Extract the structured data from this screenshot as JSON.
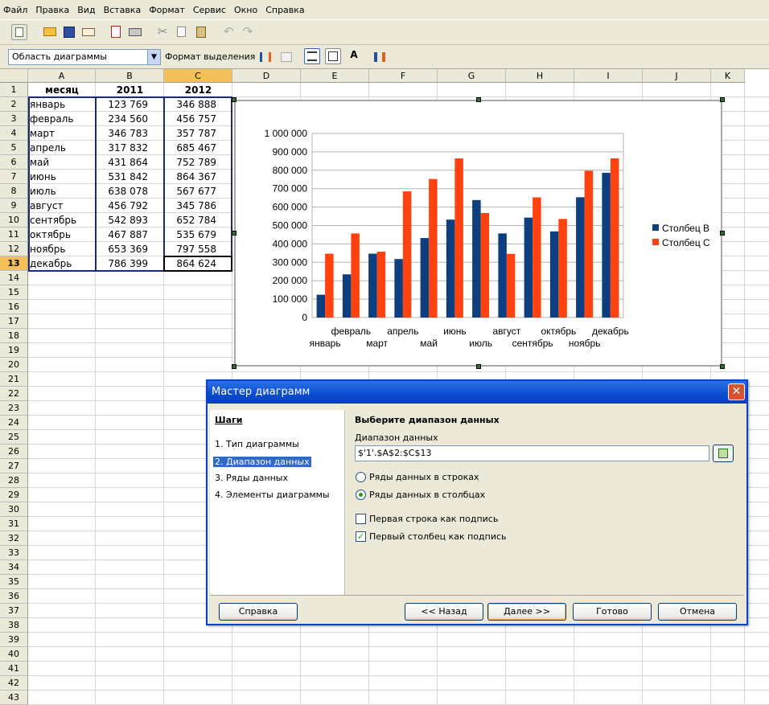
{
  "menu": [
    "Файл",
    "Правка",
    "Вид",
    "Вставка",
    "Формат",
    "Сервис",
    "Окно",
    "Справка"
  ],
  "toolbar2": {
    "area_select": "Область диаграммы",
    "format_selection": "Формат выделения"
  },
  "columns": [
    "A",
    "B",
    "C",
    "D",
    "E",
    "F",
    "G",
    "H",
    "I",
    "J",
    "K"
  ],
  "active_column": "C",
  "active_row": 13,
  "rows_visible": 43,
  "sheet": {
    "header": [
      "месяц",
      "2011",
      "2012"
    ],
    "rows": [
      [
        "январь",
        "123 769",
        "346 888"
      ],
      [
        "февраль",
        "234 560",
        "456 757"
      ],
      [
        "март",
        "346 783",
        "357 787"
      ],
      [
        "апрель",
        "317 832",
        "685 467"
      ],
      [
        "май",
        "431 864",
        "752 789"
      ],
      [
        "июнь",
        "531 842",
        "864 367"
      ],
      [
        "июль",
        "638 078",
        "567 677"
      ],
      [
        "август",
        "456 792",
        "345 786"
      ],
      [
        "сентябрь",
        "542 893",
        "652 784"
      ],
      [
        "октябрь",
        "467 887",
        "535 679"
      ],
      [
        "ноябрь",
        "653 369",
        "797 558"
      ],
      [
        "декабрь",
        "786 399",
        "864 624"
      ]
    ]
  },
  "chart_data": {
    "type": "bar",
    "categories": [
      "январь",
      "февраль",
      "март",
      "апрель",
      "май",
      "июнь",
      "июль",
      "август",
      "сентябрь",
      "октябрь",
      "ноябрь",
      "декабрь"
    ],
    "series": [
      {
        "name": "Столбец B",
        "color": "#0d3e7e",
        "values": [
          123769,
          234560,
          346783,
          317832,
          431864,
          531842,
          638078,
          456792,
          542893,
          467887,
          653369,
          786399
        ]
      },
      {
        "name": "Столбец C",
        "color": "#ff420e",
        "values": [
          346888,
          456757,
          357787,
          685467,
          752789,
          864367,
          567677,
          345786,
          652784,
          535679,
          797558,
          864624
        ]
      }
    ],
    "yticks": [
      "0",
      "100 000",
      "200 000",
      "300 000",
      "400 000",
      "500 000",
      "600 000",
      "700 000",
      "800 000",
      "900 000",
      "1 000 000"
    ],
    "ylim": [
      0,
      1000000
    ],
    "legend": "right",
    "grid": true
  },
  "dialog": {
    "title": "Мастер диаграмм",
    "steps_title": "Шаги",
    "steps": [
      "1. Тип диаграммы",
      "2. Диапазон данных",
      "3. Ряды данных",
      "4. Элементы диаграммы"
    ],
    "selected_step": 1,
    "heading": "Выберите диапазон данных",
    "range_label": "Диапазон данных",
    "range_value": "$'1'.$A$2:$C$13",
    "radio_rows": "Ряды данных в строках",
    "radio_cols": "Ряды данных в столбцах",
    "check_first_row": "Первая строка как подпись",
    "check_first_col": "Первый столбец как подпись",
    "buttons": {
      "help": "Справка",
      "back": "<< Назад",
      "next": "Далее >>",
      "finish": "Готово",
      "cancel": "Отмена"
    }
  }
}
